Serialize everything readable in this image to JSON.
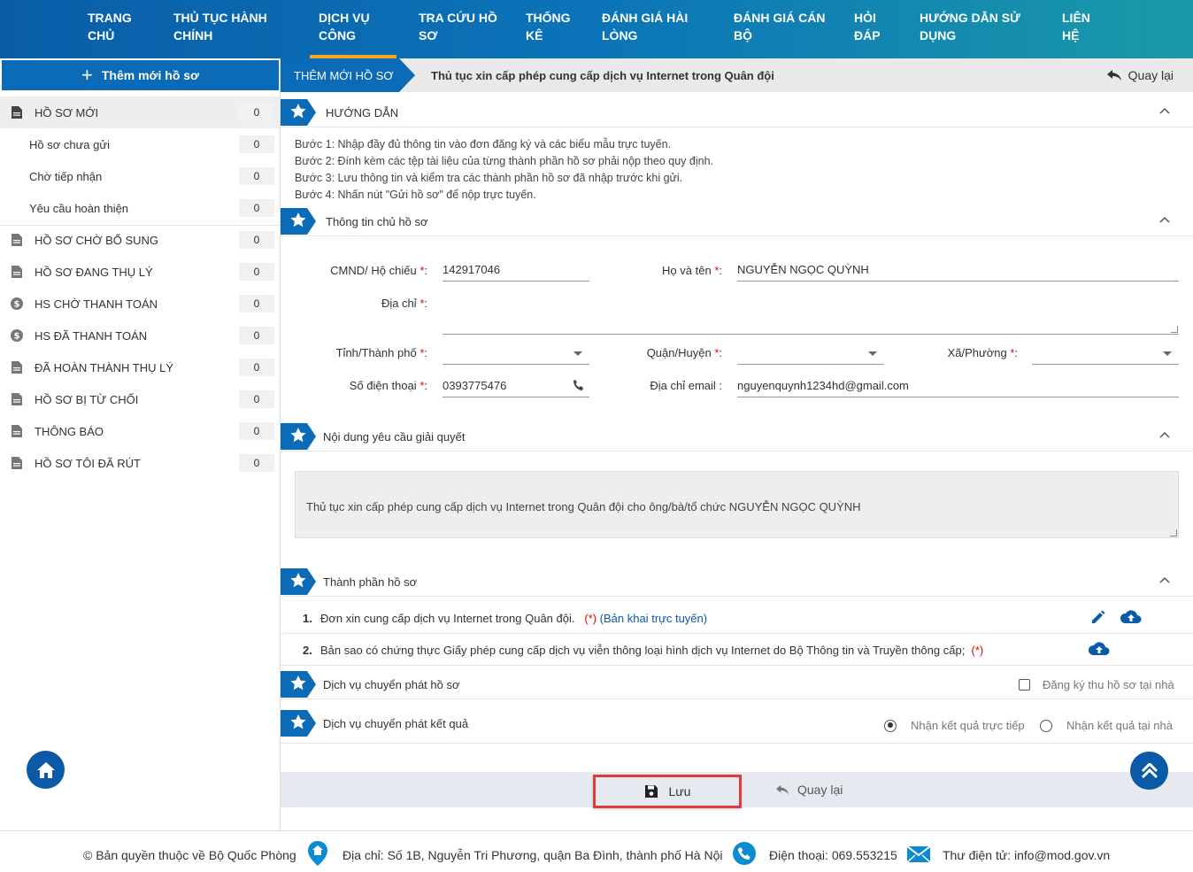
{
  "nav": {
    "items": [
      {
        "line1": "TRANG",
        "line2": "CHỦ"
      },
      {
        "line1": "THỦ TỤC HÀNH",
        "line2": "CHÍNH"
      },
      {
        "line1": "DỊCH VỤ",
        "line2": "CÔNG"
      },
      {
        "line1": "TRA CỨU HỒ",
        "line2": "SƠ"
      },
      {
        "line1": "THỐNG",
        "line2": "KÊ"
      },
      {
        "line1": "ĐÁNH GIÁ HÀI",
        "line2": "LÒNG"
      },
      {
        "line1": "ĐÁNH GIÁ CÁN",
        "line2": "BỘ"
      },
      {
        "line1": "HỎI",
        "line2": "ĐÁP"
      },
      {
        "line1": "HƯỚNG DẪN SỬ",
        "line2": "DỤNG"
      },
      {
        "line1": "LIÊN",
        "line2": "HỆ"
      }
    ],
    "active_index": 2
  },
  "sidebar": {
    "add_button": "Thêm mới hồ sơ",
    "items": [
      {
        "label": "HỒ SƠ MỚI",
        "count": "0",
        "icon": "document-icon"
      },
      {
        "label": "Hồ sơ chưa gửi",
        "count": "0"
      },
      {
        "label": "Chờ tiếp nhận",
        "count": "0"
      },
      {
        "label": "Yêu cầu hoàn thiện",
        "count": "0"
      },
      {
        "label": "HỒ SƠ CHỜ BỔ SUNG",
        "count": "0",
        "icon": "document-icon"
      },
      {
        "label": "HỒ SƠ ĐANG THỤ LÝ",
        "count": "0",
        "icon": "document-icon"
      },
      {
        "label": "HS CHỜ THANH TOÁN",
        "count": "0",
        "icon": "dollar-icon"
      },
      {
        "label": "HS ĐÃ THANH TOÁN",
        "count": "0",
        "icon": "dollar-icon"
      },
      {
        "label": "ĐÃ HOÀN THÀNH THỤ LÝ",
        "count": "0",
        "icon": "document-icon"
      },
      {
        "label": "HỒ SƠ BỊ TỪ CHỐI",
        "count": "0",
        "icon": "document-icon"
      },
      {
        "label": "THÔNG BÁO",
        "count": "0",
        "icon": "document-icon"
      },
      {
        "label": "HỒ SƠ TÔI ĐÃ RÚT",
        "count": "0",
        "icon": "document-icon"
      }
    ]
  },
  "breadcrumb": {
    "tab": "THÊM MỚI HỒ SƠ",
    "title": "Thủ tục xin cấp phép cung cấp dịch vụ Internet trong Quân đội",
    "back": "Quay lại"
  },
  "guide": {
    "title": "HƯỚNG DẪN",
    "steps": [
      "Bước 1: Nhập đầy đủ thông tin vào đơn đăng ký và các biểu mẫu trực tuyến.",
      "Bước 2: Đính kèm các tệp tài liệu của từng thành phần hồ sơ phải nộp theo quy định.",
      "Bước 3: Lưu thông tin và kiểm tra các thành phần hồ sơ đã nhập trước khi gửi.",
      "Bước 4: Nhấn nút \"Gửi hồ sơ\" để nộp trực tuyến."
    ]
  },
  "owner": {
    "title": "Thông tin chủ hồ sơ",
    "id_label": "CMND/ Hộ chiếu",
    "id_value": "142917046",
    "name_label": "Họ và tên",
    "name_value": "NGUYỄN NGỌC QUỲNH",
    "address_label": "Địa chỉ",
    "address_value": "",
    "province_label": "Tỉnh/Thành phố",
    "province_value": "",
    "district_label": "Quận/Huyện",
    "district_value": "",
    "ward_label": "Xã/Phường",
    "ward_value": "",
    "phone_label": "Số điện thoại",
    "phone_value": "0393775476",
    "email_label": "Địa chỉ email :",
    "email_value": "nguyenquynh1234hd@gmail.com",
    "required_mark": "*",
    "colon": ":"
  },
  "request": {
    "title": "Nội dung yêu cầu giải quyết",
    "text": "Thủ tục xin cấp phép cung cấp dịch vụ Internet trong Quân đội cho ông/bà/tổ chức NGUYỄN NGỌC QUỲNH"
  },
  "components": {
    "title": "Thành phần hồ sơ",
    "items": [
      {
        "num": "1.",
        "text": "Đơn xin cung cấp dịch vụ Internet trong Quân đội.",
        "required": "(*)",
        "link": "(Bản khai trực tuyến)"
      },
      {
        "num": "2.",
        "text": "Bản sao có chứng thực Giấy phép cung cấp dịch vụ viễn thông loại hình dịch vụ Internet do Bộ Thông tin và Truyền thông cấp;",
        "required": "(*)"
      }
    ]
  },
  "delivery_in": {
    "title": "Dịch vụ chuyển phát hồ sơ",
    "option": "Đăng ký thu hồ sơ tại nhà"
  },
  "delivery_out": {
    "title": "Dịch vụ chuyển phát kết quả",
    "option_direct": "Nhận kết quả trực tiếp",
    "option_home": "Nhận kết quả tại nhà",
    "selected": "direct"
  },
  "actions": {
    "save": "Lưu",
    "back": "Quay lại"
  },
  "footer": {
    "copyright": "© Bản quyền thuộc về Bộ Quốc Phòng",
    "address": "Địa chỉ: Số 1B, Nguyễn Tri Phương, quận Ba Đình, thành phố Hà Nội",
    "phone": "Điện thoại: 069.553215",
    "email": "Thư điện tử: info@mod.gov.vn"
  },
  "colors": {
    "primary": "#0b6bb6",
    "active_underline": "#f7a823",
    "highlight_border": "#e03a3a"
  }
}
